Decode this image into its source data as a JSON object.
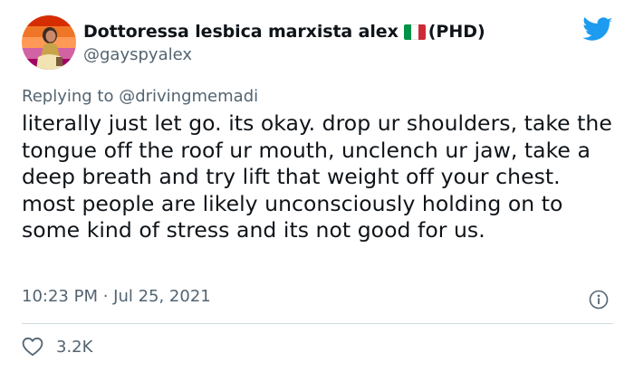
{
  "author": {
    "display_name": "Dottoressa lesbica marxista alex",
    "flag_icon": "italy-flag-icon",
    "display_name_suffix": "(PHD)",
    "handle": "@gayspyalex"
  },
  "reply": {
    "prefix": "Replying to ",
    "mention": "@drivingmemadi"
  },
  "tweet": {
    "text": "literally just let go. its okay. drop ur shoulders, take the tongue off the roof ur mouth, unclench ur jaw, take a deep breath and try lift that weight off your chest. most people are likely unconsciously holding on to some kind of stress and its not good for us."
  },
  "meta": {
    "timestamp": "10:23 PM · Jul 25, 2021"
  },
  "engagement": {
    "likes": "3.2K"
  },
  "colors": {
    "twitter_blue": "#1d9bf0",
    "secondary_text": "#536471",
    "primary_text": "#0f1419",
    "divider": "#cfd9de",
    "flag_green": "#009246",
    "flag_white": "#ffffff",
    "flag_red": "#ce2b37"
  },
  "icons": {
    "brand": "twitter-bird-icon",
    "info": "info-icon",
    "like": "heart-icon"
  }
}
